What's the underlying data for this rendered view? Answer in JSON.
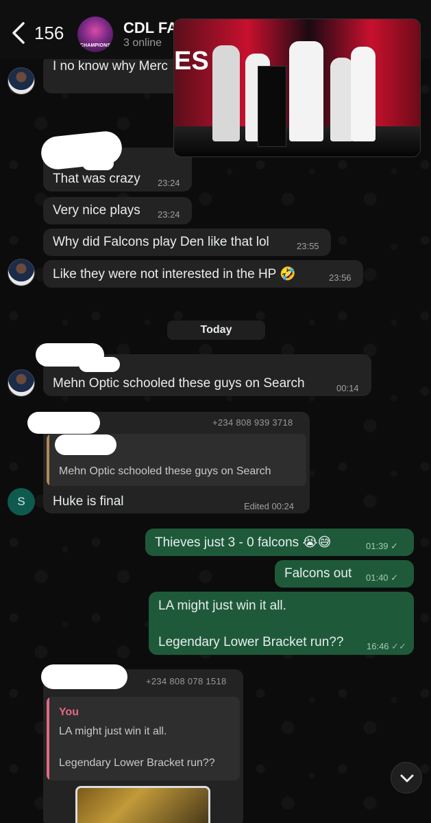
{
  "header": {
    "back_count": "156",
    "group_name": "CDL FA",
    "status": "3 online",
    "avatar_caption": "CHAMPIONS"
  },
  "pip": {
    "banner": "ES"
  },
  "messages": {
    "m1_text": "I no know why Merc",
    "m2_text": "That was crazy",
    "m2_time": "23:24",
    "m3_text": "Very nice plays",
    "m3_time": "23:24",
    "m4_text": "Why did Falcons play Den like that lol",
    "m4_time": "23:55",
    "m5_text": "Like they were not interested in the HP 🤣",
    "m5_time": "23:56",
    "date_chip": "Today",
    "m6_text": "Mehn Optic schooled these guys on Search",
    "m6_time": "00:14",
    "m7_phone": "+234 808 939 3718",
    "m7_quote": "Mehn Optic schooled these guys on Search",
    "m7_text": "Huke is final",
    "m7_edited": "Edited 00:24",
    "m7_avatar_letter": "S",
    "o1_text": "Thieves just 3 - 0 falcons 😭😅",
    "o1_time": "01:39",
    "o2_text": "Falcons out",
    "o2_time": "01:40",
    "o3_line1": "LA might just win it all.",
    "o3_line2": "Legendary Lower Bracket run??",
    "o3_time": "16:46",
    "m8_phone": "+234 808 078 1518",
    "m8_quote_author": "You",
    "m8_quote_line1": "LA might just win it all.",
    "m8_quote_line2": "Legendary Lower Bracket run??"
  },
  "colors": {
    "outgoing_bubble": "#1e5a3a",
    "incoming_bubble": "#232323",
    "quote_author": "#e26a84"
  }
}
